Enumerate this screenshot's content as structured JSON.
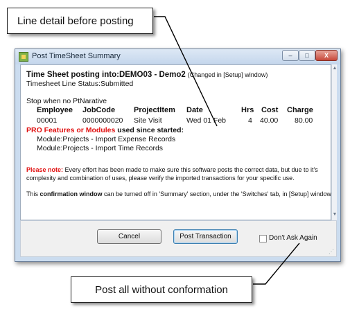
{
  "callouts": {
    "top": "Line detail before posting",
    "bottom": "Post all without conformation"
  },
  "window": {
    "title": "Post TimeSheet Summary",
    "controls": {
      "minimize": "–",
      "maximize": "□",
      "close": "X"
    }
  },
  "summary": {
    "heading": "Time Sheet posting into:DEMO03 - Demo2",
    "changed_note": "(Changed in [Setup] window)",
    "line_status": "Timesheet Line Status:Submitted",
    "stop_when": "Stop when no PtNarative",
    "columns": [
      "Employee",
      "JobCode",
      "ProjectItem",
      "Date",
      "Hrs",
      "Cost",
      "Charge"
    ],
    "rows": [
      {
        "employee": "00001",
        "jobcode": "0000000020",
        "projectitem": "Site Visit",
        "date": "Wed 01 Feb",
        "hrs": "4",
        "cost": "40.00",
        "charge": "80.00"
      }
    ],
    "pro_features_red": "PRO Features or Modules",
    "pro_features_rest": " used since started:",
    "modules": [
      "Module:Projects - Import Expense Records",
      "Module:Projects - Import Time Records"
    ],
    "note_label": "Please note:",
    "note_text_1": " Every effort has been made to make sure this software posts the correct data, but due to it's",
    "note_text_2": "complexity and combination of uses, please verify the imported transactions for your specific use.",
    "confirm_pre": "This ",
    "confirm_bold": "confirmation window",
    "confirm_post": " can be turned off in 'Summary' section, under the 'Switches' tab, in [Setup] window."
  },
  "footer": {
    "cancel_label": "Cancel",
    "post_label": "Post Transaction",
    "dont_ask_label": "Don't Ask Again"
  },
  "icons": {
    "scroll_up": "▲",
    "scroll_down": "▼",
    "grip": "⋰"
  }
}
